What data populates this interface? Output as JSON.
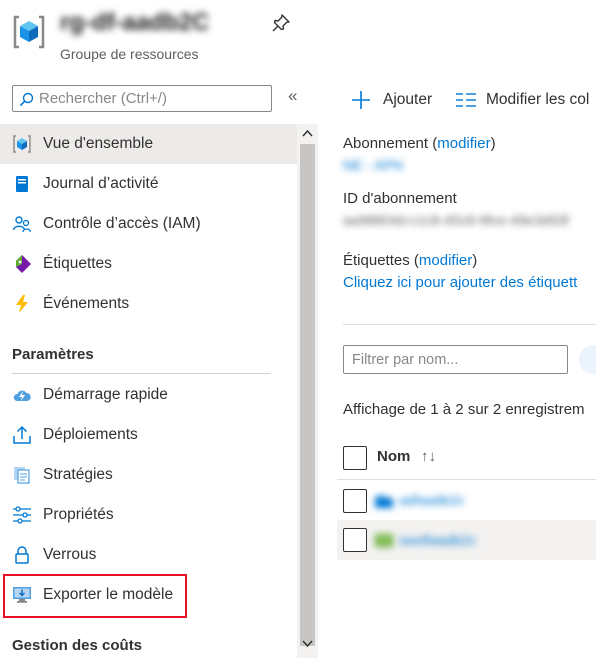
{
  "header": {
    "resource_group_name": "rg-df-aadb2C",
    "subtitle": "Groupe de ressources",
    "pin_icon": "pin-icon"
  },
  "search": {
    "placeholder": "Rechercher (Ctrl+/)",
    "collapse_label": "«"
  },
  "sidebar": {
    "items": [
      {
        "label": "Vue d'ensemble",
        "icon": "overview-cube-icon",
        "active": true
      },
      {
        "label": "Journal d’activité",
        "icon": "activity-log-icon"
      },
      {
        "label": "Contrôle d’accès (IAM)",
        "icon": "people-iam-icon"
      },
      {
        "label": "Étiquettes",
        "icon": "tag-icon"
      },
      {
        "label": "Événements",
        "icon": "lightning-icon"
      }
    ],
    "section_settings": "Paramètres",
    "settings_items": [
      {
        "label": "Démarrage rapide",
        "icon": "cloud-quickstart-icon"
      },
      {
        "label": "Déploiements",
        "icon": "upload-deploy-icon"
      },
      {
        "label": "Stratégies",
        "icon": "policy-document-icon"
      },
      {
        "label": "Propriétés",
        "icon": "sliders-properties-icon"
      },
      {
        "label": "Verrous",
        "icon": "lock-icon"
      },
      {
        "label": "Exporter le modèle",
        "icon": "monitor-export-icon",
        "highlighted": true
      }
    ],
    "section_costs": "Gestion des coûts"
  },
  "toolbar": {
    "add_label": "Ajouter",
    "edit_columns_label": "Modifier les col"
  },
  "essentials": {
    "subscription_label": "Abonnement",
    "modify_link": "modifier",
    "subscription_value": "NE - APN",
    "subscription_id_label": "ID d'abonnement",
    "subscription_id_value": "aa98804d-c1c8-45c8-9fce-49e3d93f",
    "tags_label": "Étiquettes",
    "tags_add_link": "Cliquez ici pour ajouter des étiquett"
  },
  "resources": {
    "filter_placeholder": "Filtrer par nom...",
    "count_text": "Affichage de 1 à 2 sur 2 enregistrem",
    "column_name": "Nom",
    "sort_glyph": "↑↓",
    "rows": [
      {
        "name": "adfaadb2c",
        "icon": "data-factory-icon",
        "selected": false
      },
      {
        "name": "swsflaadb2c",
        "icon": "storage-icon",
        "selected": true
      }
    ]
  },
  "colors": {
    "accent": "#0078d4",
    "highlight_border": "#e81123",
    "active_row": "#edebe9"
  }
}
